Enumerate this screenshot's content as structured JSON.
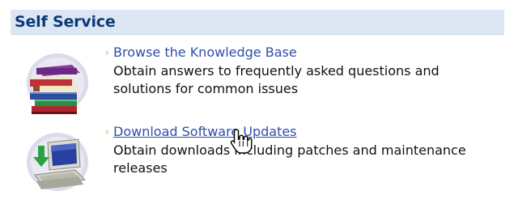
{
  "header": {
    "title": "Self Service"
  },
  "items": [
    {
      "link": "Browse the Knowledge Base",
      "description": "Obtain answers to frequently asked questions and solutions for common issues",
      "icon": "books-icon"
    },
    {
      "link": "Download Software Updates",
      "description": "Obtain downloads including patches and maintenance releases",
      "icon": "computer-download-icon"
    }
  ],
  "colors": {
    "header_bg": "#dde7f4",
    "header_text": "#0b3a78",
    "link": "#2c4fa8",
    "bullet": "#e8a545"
  }
}
